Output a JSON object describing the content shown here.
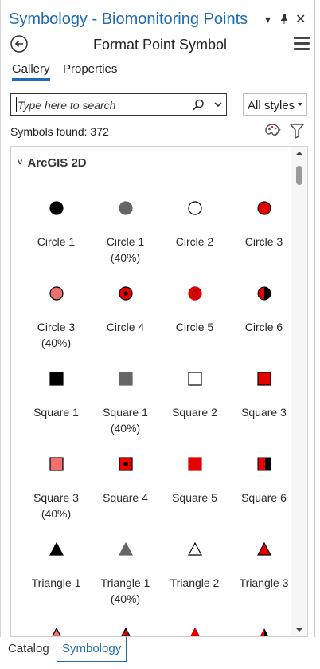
{
  "window": {
    "title": "Symbology - Biomonitoring Points",
    "pin_glyph": "❙",
    "dropdown_glyph": "▾",
    "close_glyph": "✕"
  },
  "header": {
    "title": "Format Point Symbol"
  },
  "tabs": [
    {
      "label": "Gallery",
      "active": true
    },
    {
      "label": "Properties",
      "active": false
    }
  ],
  "search": {
    "placeholder": "Type here to search",
    "value": ""
  },
  "styles_dropdown": {
    "selected": "All styles"
  },
  "symbols_found": "Symbols found: 372",
  "gallery": {
    "group_name": "ArcGIS 2D",
    "items": [
      {
        "shape": "circle",
        "fill": "#000000",
        "stroke": "#000000",
        "label": [
          "Circle 1"
        ]
      },
      {
        "shape": "circle",
        "fill": "#666666",
        "stroke": "#666666",
        "label": [
          "Circle 1",
          "(40%)"
        ]
      },
      {
        "shape": "circle",
        "fill": "#ffffff",
        "stroke": "#000000",
        "label": [
          "Circle 2"
        ]
      },
      {
        "shape": "circle",
        "fill": "#e60000",
        "stroke": "#000000",
        "label": [
          "Circle 3"
        ]
      },
      {
        "shape": "circle",
        "fill": "#f07070",
        "stroke": "#000000",
        "label": [
          "Circle 3",
          "(40%)"
        ]
      },
      {
        "shape": "circle-dot",
        "fill": "#e60000",
        "stroke": "#000000",
        "label": [
          "Circle 4"
        ]
      },
      {
        "shape": "circle-ring",
        "fill": "#e60000",
        "stroke": "#cc0000",
        "label": [
          "Circle 5"
        ]
      },
      {
        "shape": "circle-half",
        "fill": "#e60000",
        "stroke": "#000000",
        "label": [
          "Circle 6"
        ]
      },
      {
        "shape": "square",
        "fill": "#000000",
        "stroke": "#000000",
        "label": [
          "Square 1"
        ]
      },
      {
        "shape": "square",
        "fill": "#666666",
        "stroke": "#666666",
        "label": [
          "Square 1",
          "(40%)"
        ]
      },
      {
        "shape": "square",
        "fill": "#ffffff",
        "stroke": "#000000",
        "label": [
          "Square 2"
        ]
      },
      {
        "shape": "square",
        "fill": "#e60000",
        "stroke": "#000000",
        "label": [
          "Square 3"
        ]
      },
      {
        "shape": "square",
        "fill": "#f07070",
        "stroke": "#000000",
        "label": [
          "Square 3",
          "(40%)"
        ]
      },
      {
        "shape": "square-dot",
        "fill": "#e60000",
        "stroke": "#000000",
        "label": [
          "Square 4"
        ]
      },
      {
        "shape": "square",
        "fill": "#e60000",
        "stroke": "#cc0000",
        "label": [
          "Square 5"
        ]
      },
      {
        "shape": "square-half",
        "fill": "#e60000",
        "stroke": "#000000",
        "label": [
          "Square 6"
        ]
      },
      {
        "shape": "triangle",
        "fill": "#000000",
        "stroke": "#000000",
        "label": [
          "Triangle 1"
        ]
      },
      {
        "shape": "triangle",
        "fill": "#666666",
        "stroke": "#666666",
        "label": [
          "Triangle 1",
          "(40%)"
        ]
      },
      {
        "shape": "triangle",
        "fill": "#ffffff",
        "stroke": "#000000",
        "label": [
          "Triangle 2"
        ]
      },
      {
        "shape": "triangle",
        "fill": "#e60000",
        "stroke": "#000000",
        "label": [
          "Triangle 3"
        ]
      },
      {
        "shape": "triangle",
        "fill": "#f07070",
        "stroke": "#000000",
        "label": []
      },
      {
        "shape": "triangle-dot",
        "fill": "#e60000",
        "stroke": "#000000",
        "label": []
      },
      {
        "shape": "triangle",
        "fill": "#e60000",
        "stroke": "#cc0000",
        "label": []
      },
      {
        "shape": "triangle-half",
        "fill": "#e60000",
        "stroke": "#000000",
        "label": []
      }
    ]
  },
  "bottom_tabs": [
    {
      "label": "Catalog",
      "active": false
    },
    {
      "label": "Symbology",
      "active": true
    }
  ],
  "colors": {
    "accent": "#1e6bb5",
    "symbol_red": "#e60000"
  }
}
